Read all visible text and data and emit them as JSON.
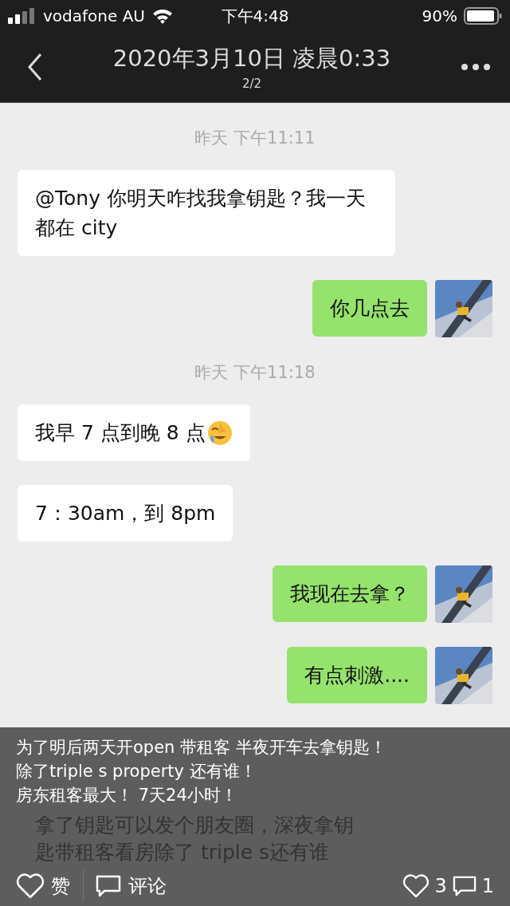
{
  "status_bar": {
    "carrier": "vodafone AU",
    "time": "下午4:48",
    "battery": "90%"
  },
  "header": {
    "title": "2020年3月10日 凌晨0:33",
    "counter": "2/2"
  },
  "messages": [
    {
      "kind": "time",
      "text": "昨天 下午11:11"
    },
    {
      "kind": "incoming",
      "text": "@Tony 你明天咋找我拿钥匙？我一天都在 city"
    },
    {
      "kind": "outgoing",
      "text": "你几点去"
    },
    {
      "kind": "time",
      "text": "昨天 下午11:18"
    },
    {
      "kind": "incoming",
      "text": "我早 7 点到晚 8 点",
      "emoji": true
    },
    {
      "kind": "incoming",
      "text": "7：30am，到 8pm"
    },
    {
      "kind": "outgoing",
      "text": "我现在去拿？"
    },
    {
      "kind": "outgoing",
      "text": "有点刺激...."
    }
  ],
  "caption": [
    "为了明后两天开open 带租客 半夜开车去拿钥匙！",
    "除了triple s property 还有谁！",
    "房东租客最大！ 7天24小时！"
  ],
  "covered_message": "拿了钥匙可以发个朋友圈，深夜拿钥匙带租客看房除了 triple s还有谁",
  "actions": {
    "like": "赞",
    "comment": "评论",
    "like_count": "3",
    "comment_count": "1"
  }
}
